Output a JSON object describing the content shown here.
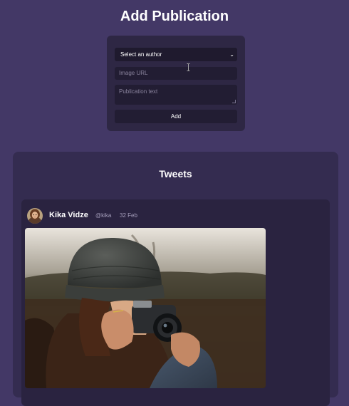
{
  "header": {
    "title": "Add Publication"
  },
  "form": {
    "author_select": {
      "selected": "Select an author"
    },
    "image_url": {
      "placeholder": "Image URL"
    },
    "publication_text": {
      "placeholder": "Publication text"
    },
    "add_label": "Add"
  },
  "tweets": {
    "title": "Tweets",
    "items": [
      {
        "author": "Kika Vidze",
        "handle": "@kika",
        "date": "32 Feb",
        "image_icon": "photo-woman-with-camera"
      }
    ]
  },
  "icons": {
    "select_chevron": "chevron-down-icon",
    "cursor": "text-cursor-icon"
  },
  "colors": {
    "background": "#433866",
    "form_card": "#2e2744",
    "tweets_panel": "#342c50",
    "tweet_card": "#2a2340",
    "input": "#221d33"
  }
}
